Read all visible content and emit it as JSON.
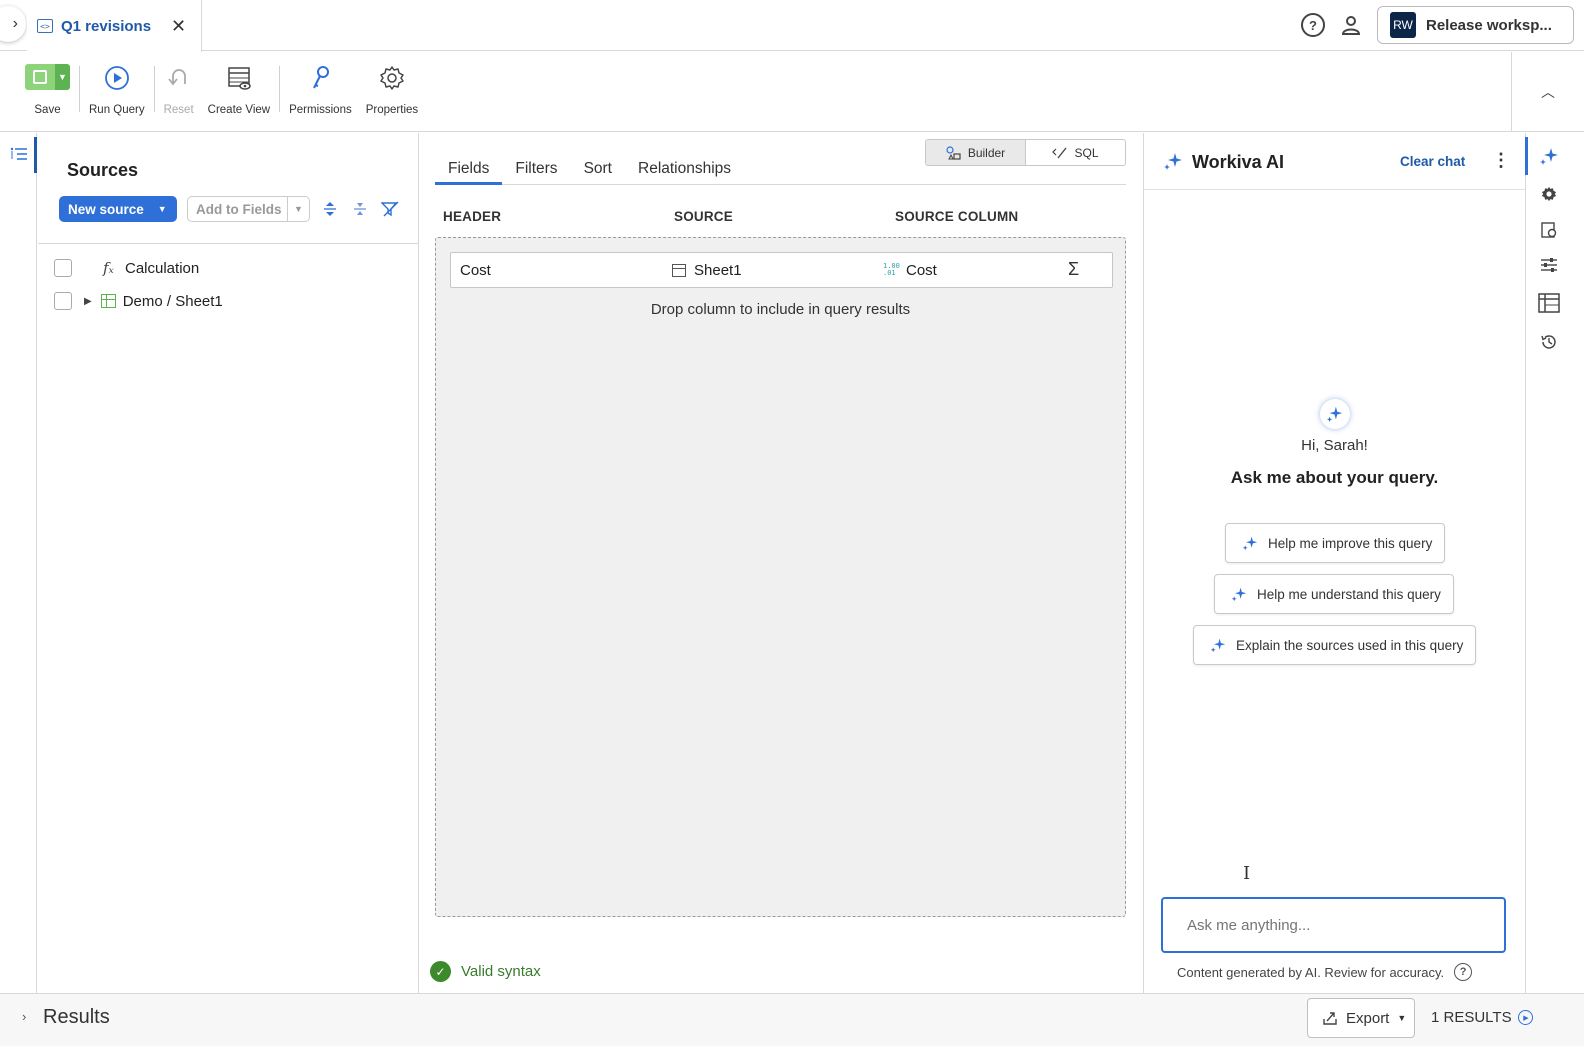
{
  "tab": {
    "title": "Q1 revisions"
  },
  "header": {
    "workspace_initials": "RW",
    "workspace_name": "Release worksp..."
  },
  "toolbar": {
    "save": "Save",
    "run_query": "Run Query",
    "reset": "Reset",
    "create_view": "Create View",
    "permissions": "Permissions",
    "properties": "Properties"
  },
  "sources": {
    "title": "Sources",
    "new_source": "New source",
    "add_to_fields": "Add to Fields",
    "items": [
      {
        "label": "Calculation"
      },
      {
        "label": "Demo / Sheet1"
      }
    ]
  },
  "builder": {
    "mode_builder": "Builder",
    "mode_sql": "SQL",
    "tabs": [
      "Fields",
      "Filters",
      "Sort",
      "Relationships"
    ],
    "columns": {
      "header": "HEADER",
      "source": "SOURCE",
      "source_column": "SOURCE COLUMN"
    },
    "fields": [
      {
        "header": "Cost",
        "source": "Sheet1",
        "source_column": "Cost",
        "num_badge": "1.00\n.01"
      }
    ],
    "drop_hint": "Drop column to include in query results",
    "status": "Valid syntax"
  },
  "ai": {
    "title": "Workiva AI",
    "clear_chat": "Clear chat",
    "greeting": "Hi, Sarah!",
    "heading": "Ask me about your query.",
    "suggestions": [
      "Help me improve this query",
      "Help me understand this query",
      "Explain the sources used in this query"
    ],
    "input_placeholder": "Ask me anything...",
    "disclaimer": "Content generated by AI. Review for accuracy."
  },
  "results": {
    "title": "Results",
    "export": "Export",
    "count": "1 RESULTS"
  },
  "colors": {
    "accent": "#2e6fd8",
    "link": "#1f5aa8",
    "save_green": "#8cd37a",
    "valid_green": "#3d8a2c"
  }
}
